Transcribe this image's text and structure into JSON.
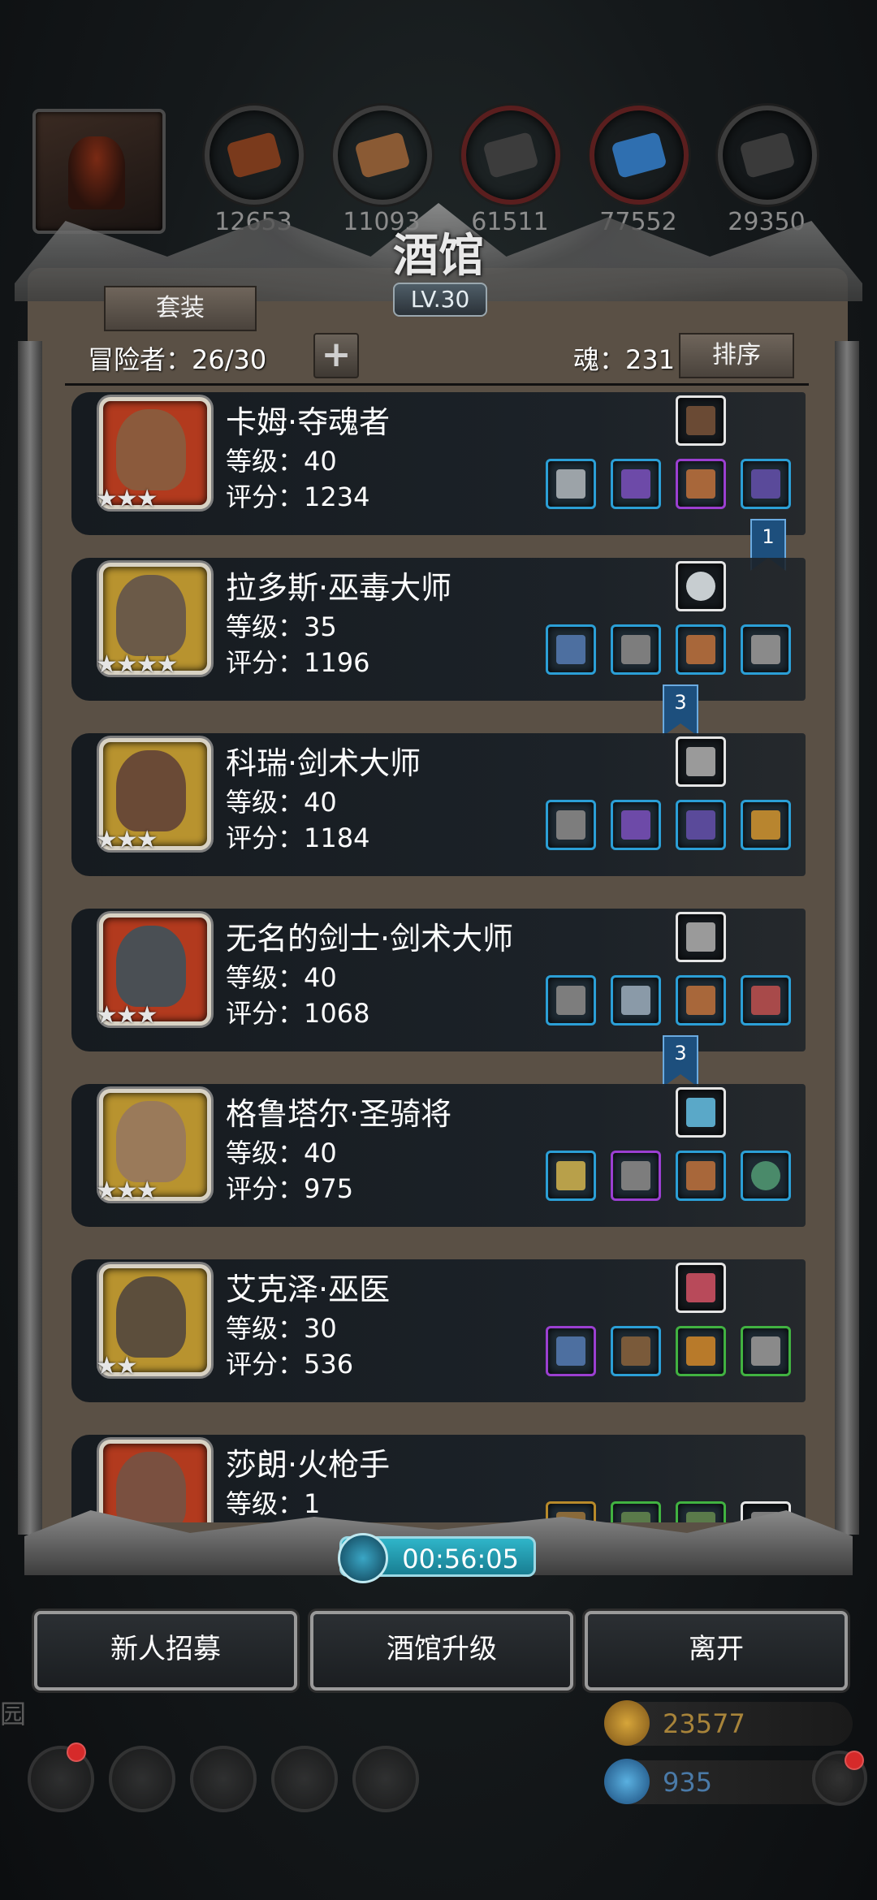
{
  "resources": {
    "values": [
      "12653",
      "11093",
      "61511",
      "77552",
      "29350"
    ],
    "colors": [
      "#7a3a1c",
      "#8a5a34",
      "#3c3c3c",
      "#2f6fb0",
      "#3a3a3a"
    ]
  },
  "tavern": {
    "title": "酒馆",
    "level": "LV.30",
    "set_label": "套装",
    "adventurers_label": "冒险者：26/30",
    "add_label": "+",
    "soul_label": "魂：231",
    "sort_label": "排序"
  },
  "heroes": [
    {
      "name": "卡姆·夺魂者",
      "level": "等级：40",
      "score": "评分：1234",
      "stars": "★★★",
      "rarity": "red",
      "face": "#8b5a3c"
    },
    {
      "name": "拉多斯·巫毒大师",
      "level": "等级：35",
      "score": "评分：1196",
      "stars": "★★★★",
      "rarity": "gold",
      "face": "#6b5a48"
    },
    {
      "name": "科瑞·剑术大师",
      "level": "等级：40",
      "score": "评分：1184",
      "stars": "★★★",
      "rarity": "gold",
      "face": "#6a4a36"
    },
    {
      "name": "无名的剑士·剑术大师",
      "level": "等级：40",
      "score": "评分：1068",
      "stars": "★★★",
      "rarity": "red",
      "face": "#4a4f54"
    },
    {
      "name": "格鲁塔尔·圣骑将",
      "level": "等级：40",
      "score": "评分：975",
      "stars": "★★★",
      "rarity": "gold",
      "face": "#9a7a5a"
    },
    {
      "name": "艾克泽·巫医",
      "level": "等级：30",
      "score": "评分：536",
      "stars": "★★",
      "rarity": "gold",
      "face": "#5c4e3c"
    },
    {
      "name": "莎朗·火枪手",
      "level": "等级：1",
      "score": "",
      "stars": "",
      "rarity": "red",
      "face": "#7a5040"
    }
  ],
  "bookmarks": [
    "1",
    "3",
    "3"
  ],
  "timer": "00:56:05",
  "actions": {
    "recruit": "新人招募",
    "upgrade": "酒馆升级",
    "leave": "离开"
  },
  "hud": {
    "garden": "园",
    "gold": "23577",
    "gems": "935"
  }
}
